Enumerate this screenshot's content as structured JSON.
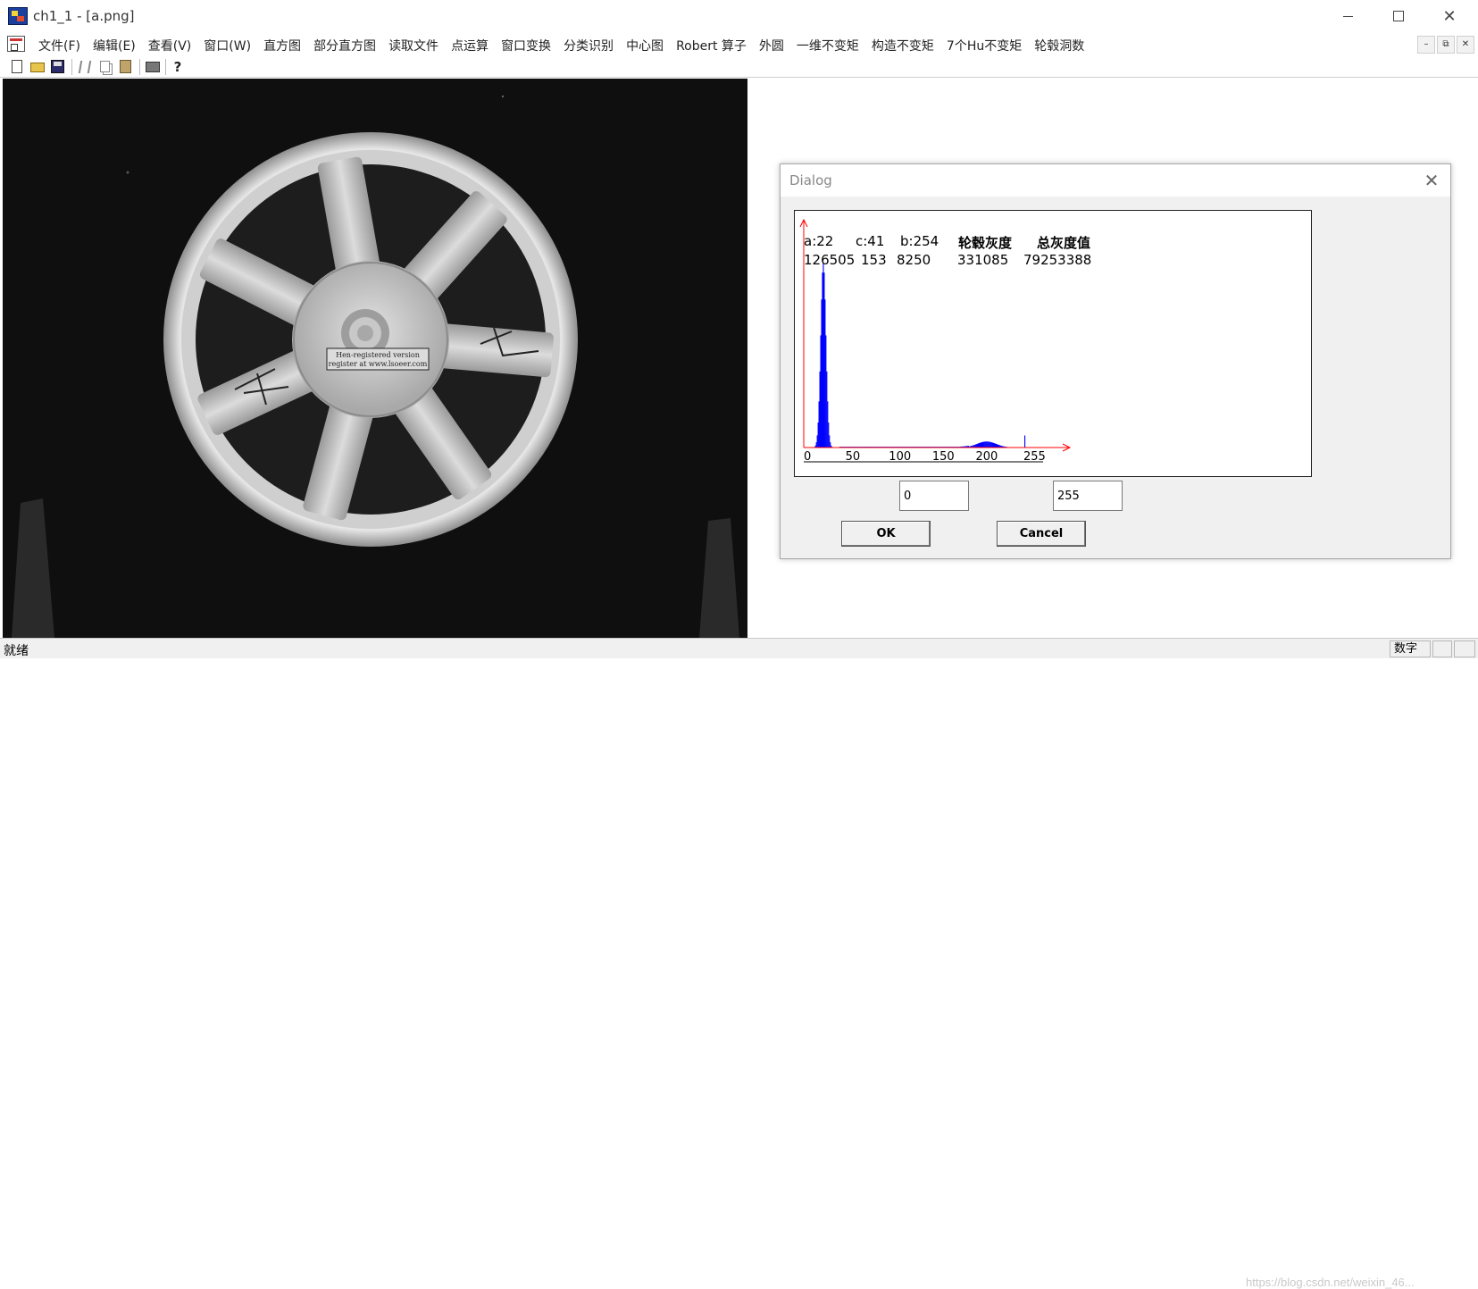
{
  "window": {
    "title": "ch1_1 - [a.png]"
  },
  "menu": {
    "items": [
      "文件(F)",
      "编辑(E)",
      "查看(V)",
      "窗口(W)",
      "直方图",
      "部分直方图",
      "读取文件",
      "点运算",
      "窗口变换",
      "分类识别",
      "中心图",
      "Robert 算子",
      "外圆",
      "一维不变矩",
      "构造不变矩",
      "7个Hu不变矩",
      "轮毂洞数"
    ]
  },
  "toolbar": {
    "icons": [
      "new-icon",
      "open-icon",
      "save-icon",
      "cut-icon",
      "copy-icon",
      "paste-icon",
      "print-icon",
      "help-icon"
    ]
  },
  "image": {
    "stamp_line1": "Hen-registered version",
    "stamp_line2": "register at www.lsoeer.com"
  },
  "dialog": {
    "title": "Dialog",
    "stats_labels": [
      "a:22",
      "c:41",
      "b:254",
      "轮毂灰度",
      "总灰度值"
    ],
    "stats_values": [
      "126505",
      "153",
      "8250",
      "331085",
      "79253388"
    ],
    "low_value": "0",
    "high_value": "255",
    "ok_label": "OK",
    "cancel_label": "Cancel"
  },
  "chart_data": {
    "type": "bar",
    "x_tick_labels": [
      "0",
      "50",
      "100",
      "150",
      "200",
      "255"
    ],
    "xlim": [
      0,
      255
    ],
    "series_color": "#0000ff",
    "axis_color": "#ff0000",
    "peaks": [
      {
        "x": 22,
        "relative_height": 0.92
      },
      {
        "x": 254,
        "relative_height": 0.06
      }
    ]
  },
  "status": {
    "ready": "就绪",
    "numlock": "数字",
    "watermark": "https://blog.csdn.net/weixin_46..."
  },
  "colors": {
    "image_background": "#0f0f0f",
    "histogram_bars": "#0000ff",
    "histogram_axes": "#ff0000"
  }
}
